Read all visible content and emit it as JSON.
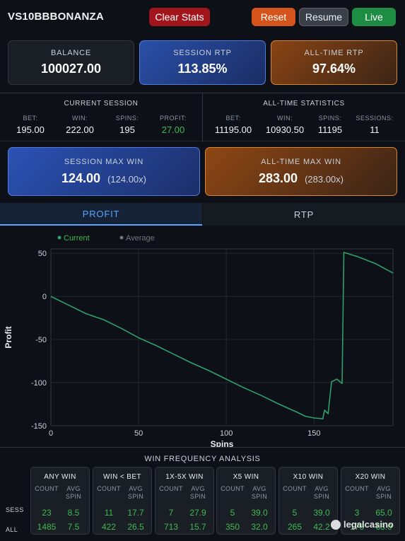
{
  "app": {
    "title": "VS10BBBONANZA"
  },
  "toolbar": {
    "clear_label": "Clear Stats",
    "reset_label": "Reset",
    "resume_label": "Resume",
    "live_label": "Live"
  },
  "summary": {
    "balance": {
      "label": "BALANCE",
      "value": "100027.00"
    },
    "session_rtp": {
      "label": "SESSION RTP",
      "value": "113.85%"
    },
    "alltime_rtp": {
      "label": "ALL-TIME RTP",
      "value": "97.64%"
    }
  },
  "current_session": {
    "title": "CURRENT SESSION",
    "items": [
      {
        "label": "BET:",
        "value": "195.00"
      },
      {
        "label": "WIN:",
        "value": "222.00"
      },
      {
        "label": "SPINS:",
        "value": "195"
      },
      {
        "label": "PROFIT:",
        "value": "27.00"
      }
    ]
  },
  "alltime_stats": {
    "title": "ALL-TIME STATISTICS",
    "items": [
      {
        "label": "BET:",
        "value": "11195.00"
      },
      {
        "label": "WIN:",
        "value": "10930.50"
      },
      {
        "label": "SPINS:",
        "value": "11195"
      },
      {
        "label": "SESSIONS:",
        "value": "11"
      }
    ]
  },
  "max_wins": {
    "session": {
      "label": "SESSION MAX WIN",
      "value": "124.00",
      "multiplier": "(124.00x)"
    },
    "alltime": {
      "label": "ALL-TIME MAX WIN",
      "value": "283.00",
      "multiplier": "(283.00x)"
    }
  },
  "tabs": {
    "profit": "PROFIT",
    "rtp": "RTP"
  },
  "colors": {
    "accent_blue": "#58a6ff",
    "profit_green": "#3fb950",
    "line_green": "#2ea06a",
    "reset_orange": "#d4541b",
    "clear_red": "#a3151d",
    "live_green": "#1f8c44"
  },
  "chart_data": {
    "type": "line",
    "xlabel": "Spins",
    "ylabel": "Profit",
    "xlim": [
      0,
      195
    ],
    "ylim": [
      -150,
      55
    ],
    "x_ticks": [
      0,
      50,
      100,
      150
    ],
    "y_ticks": [
      50,
      0,
      -50,
      -100,
      -150
    ],
    "legend": {
      "placement": "top-left"
    },
    "grid": true,
    "series": [
      {
        "name": "Current",
        "color": "#2ea06a",
        "points": [
          [
            0,
            0
          ],
          [
            10,
            -10
          ],
          [
            20,
            -20
          ],
          [
            30,
            -27
          ],
          [
            40,
            -37
          ],
          [
            50,
            -48
          ],
          [
            60,
            -57
          ],
          [
            70,
            -67
          ],
          [
            80,
            -77
          ],
          [
            90,
            -86
          ],
          [
            100,
            -96
          ],
          [
            110,
            -106
          ],
          [
            120,
            -115
          ],
          [
            130,
            -125
          ],
          [
            140,
            -134
          ],
          [
            145,
            -139
          ],
          [
            150,
            -141
          ],
          [
            155,
            -142
          ],
          [
            156,
            -132
          ],
          [
            158,
            -136
          ],
          [
            160,
            -99
          ],
          [
            163,
            -96
          ],
          [
            166,
            -101
          ],
          [
            167,
            51
          ],
          [
            175,
            46
          ],
          [
            185,
            38
          ],
          [
            195,
            27
          ]
        ]
      },
      {
        "name": "Average",
        "color": "#6e7681",
        "points": []
      }
    ]
  },
  "win_frequency": {
    "title": "WIN FREQUENCY ANALYSIS",
    "row_labels": {
      "sess": "SESS",
      "all": "ALL"
    },
    "count_header": "COUNT",
    "avg_header": "AVG\nSPIN",
    "cards": [
      {
        "title": "ANY WIN",
        "sess_count": "23",
        "sess_avg": "8.5",
        "all_count": "1485",
        "all_avg": "7.5"
      },
      {
        "title": "WIN < BET",
        "sess_count": "11",
        "sess_avg": "17.7",
        "all_count": "422",
        "all_avg": "26.5"
      },
      {
        "title": "1X-5X WIN",
        "sess_count": "7",
        "sess_avg": "27.9",
        "all_count": "713",
        "all_avg": "15.7"
      },
      {
        "title": "X5 WIN",
        "sess_count": "5",
        "sess_avg": "39.0",
        "all_count": "350",
        "all_avg": "32.0"
      },
      {
        "title": "X10 WIN",
        "sess_count": "5",
        "sess_avg": "39.0",
        "all_count": "265",
        "all_avg": "42.2"
      },
      {
        "title": "X20 WIN",
        "sess_count": "3",
        "sess_avg": "65.0",
        "all_count": "176",
        "all_avg": "63.0"
      }
    ]
  },
  "watermark": {
    "text": "legalcasino"
  }
}
